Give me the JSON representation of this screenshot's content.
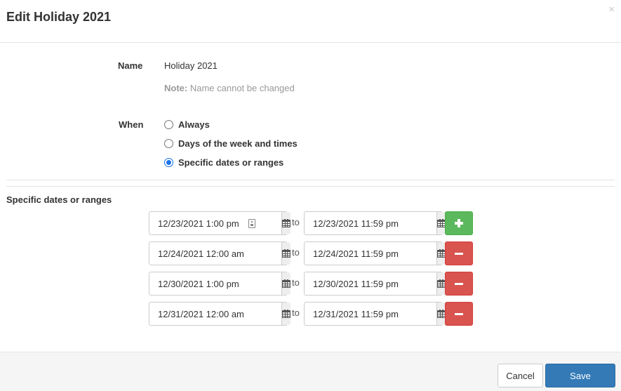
{
  "dialog": {
    "title": "Edit Holiday 2021",
    "close_glyph": "×"
  },
  "name_field": {
    "label": "Name",
    "value": "Holiday 2021",
    "note_prefix": "Note:",
    "note_text": "Name cannot be changed"
  },
  "when": {
    "label": "When",
    "options": [
      {
        "label": "Always",
        "checked": false
      },
      {
        "label": "Days of the week and times",
        "checked": false
      },
      {
        "label": "Specific dates or ranges",
        "checked": true
      }
    ]
  },
  "ranges_section": {
    "title": "Specific dates or ranges",
    "separator": "to",
    "rows": [
      {
        "from": "12/23/2021 1:00 pm",
        "to": "12/23/2021 11:59 pm",
        "action": "add"
      },
      {
        "from": "12/24/2021 12:00 am",
        "to": "12/24/2021 11:59 pm",
        "action": "remove"
      },
      {
        "from": "12/30/2021 1:00 pm",
        "to": "12/30/2021 11:59 pm",
        "action": "remove"
      },
      {
        "from": "12/31/2021 12:00 am",
        "to": "12/31/2021 11:59 pm",
        "action": "remove"
      }
    ]
  },
  "footer": {
    "cancel_label": "Cancel",
    "save_label": "Save"
  },
  "colors": {
    "save": "#337ab7",
    "add": "#5cb85c",
    "remove": "#d9534f",
    "radio_checked": "#1a73e8"
  },
  "icons": {
    "calendar": "calendar-icon",
    "plus": "plus-icon",
    "minus": "minus-icon",
    "close": "close-icon",
    "contact-card": "contact-card-icon"
  }
}
